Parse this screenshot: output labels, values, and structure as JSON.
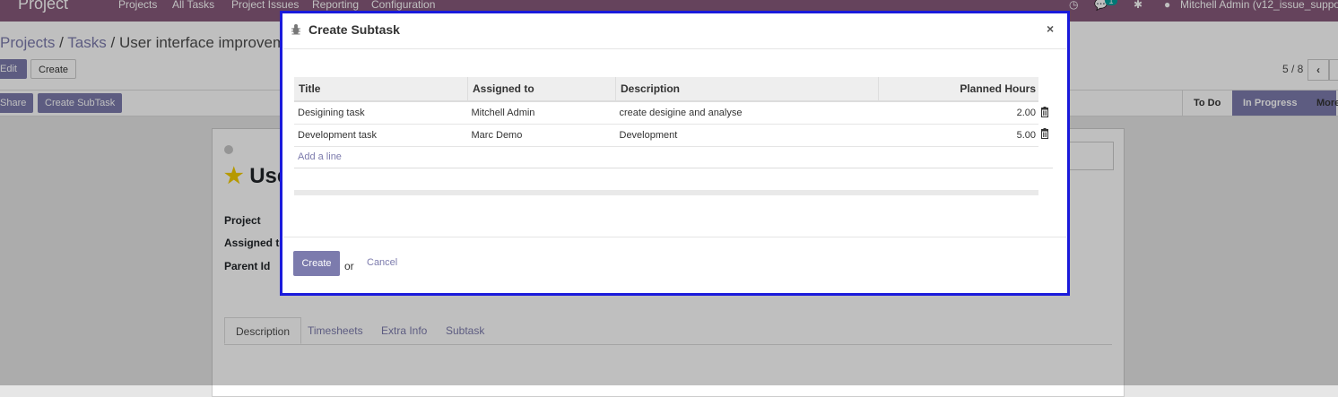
{
  "topbar": {
    "app_name": "Project",
    "menu": [
      "Projects",
      "All Tasks",
      "Project Issues",
      "Reporting",
      "Configuration"
    ],
    "message_count": "1",
    "user": "Mitchell Admin (v12_issue_suppor"
  },
  "breadcrumb": {
    "items": [
      "Projects",
      "Tasks"
    ],
    "current": "User interface improvement"
  },
  "toolbar": {
    "edit_label": "Edit",
    "create_label": "Create",
    "share_label": "Share",
    "create_subtask_label": "Create SubTask",
    "pager": "5 / 8"
  },
  "stages": [
    "To Do",
    "In Progress",
    "More"
  ],
  "sheet": {
    "title": "Use",
    "fields": [
      "Project",
      "Assigned to",
      "Parent Id"
    ],
    "tabs": [
      "Description",
      "Timesheets",
      "Extra Info",
      "Subtask"
    ]
  },
  "modal": {
    "title": "Create Subtask",
    "columns": [
      "Title",
      "Assigned to",
      "Description",
      "Planned Hours"
    ],
    "rows": [
      {
        "title": "Desigining task",
        "assigned": "Mitchell Admin",
        "description": "create desigine and analyse",
        "hours": "2.00"
      },
      {
        "title": "Development task",
        "assigned": "Marc Demo",
        "description": "Development",
        "hours": "5.00"
      }
    ],
    "add_line": "Add a line",
    "create_label": "Create",
    "or_label": "or",
    "cancel_label": "Cancel"
  },
  "colors": {
    "brand": "#875a7b",
    "accent": "#7c7bad",
    "highlight_border": "#1a1adb"
  }
}
